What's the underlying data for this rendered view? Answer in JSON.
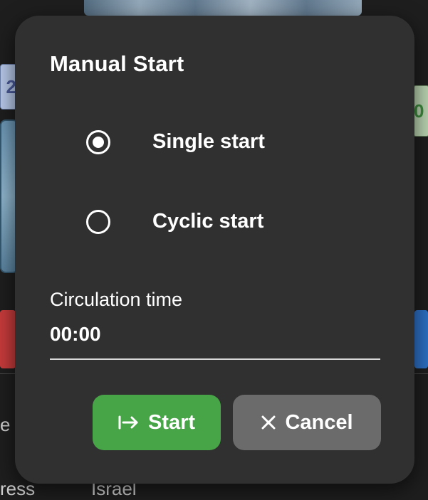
{
  "background": {
    "left_field_text": "2",
    "right_field_text": "0",
    "bottom_left_text_1": "e",
    "bottom_left_text_2": "ress",
    "bottom_text_3": "Israel"
  },
  "dialog": {
    "title": "Manual Start",
    "options": [
      {
        "label": "Single start",
        "selected": true
      },
      {
        "label": "Cyclic start",
        "selected": false
      }
    ],
    "field": {
      "label": "Circulation time",
      "value": "00:00"
    },
    "buttons": {
      "start_label": "Start",
      "start_icon": "arrow-to-right-icon",
      "cancel_label": "Cancel",
      "cancel_icon": "close-icon"
    },
    "colors": {
      "dialog_bg": "#303030",
      "start_button": "#47a447",
      "cancel_button": "#6b6b6b"
    }
  }
}
